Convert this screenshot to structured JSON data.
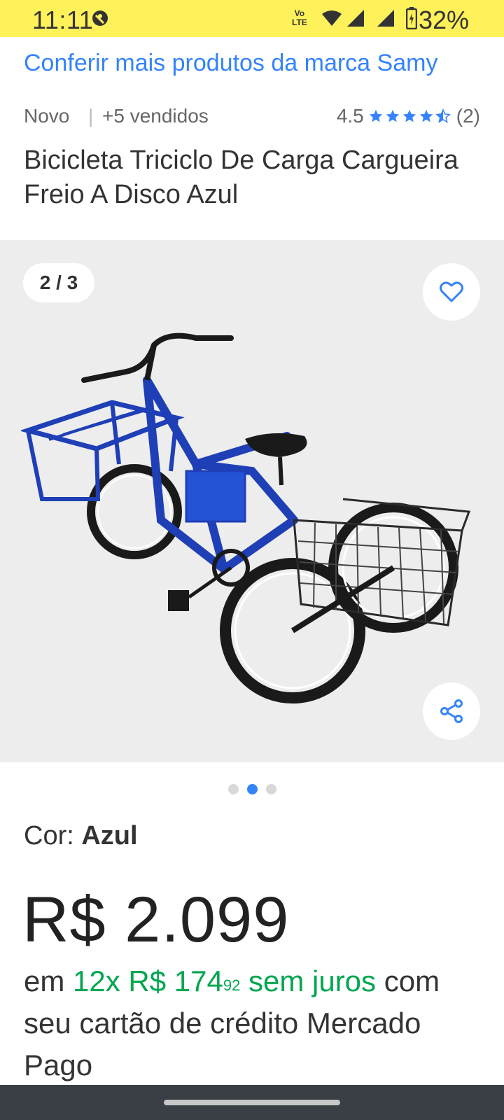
{
  "status_bar": {
    "time": "11:11",
    "battery_percent": "32%",
    "icons": [
      "do-not-disturb-icon",
      "volte-icon",
      "wifi-icon",
      "signal-icon",
      "signal-icon-2",
      "battery-charging-icon"
    ],
    "background": "#fff159"
  },
  "header": {
    "brand_link": "Conferir mais produtos da marca Samy"
  },
  "meta": {
    "condition": "Novo",
    "separator": "|",
    "sold": "+5 vendidos",
    "rating_value": "4.5",
    "rating_count": "(2)",
    "stars": 4.5
  },
  "product": {
    "title": "Bicicleta Triciclo De Carga Cargueira Freio A Disco Azul"
  },
  "gallery": {
    "counter": "2 / 3",
    "current_index": 2,
    "total": 3,
    "favorite_icon": "heart-icon",
    "share_icon": "share-icon",
    "image_alt": "tricycle-blue-product-photo"
  },
  "color": {
    "label": "Cor: ",
    "value": "Azul"
  },
  "price": {
    "main": "R$ 2.099",
    "installments_prefix": "em ",
    "installments_count": "12x R$ 174",
    "installments_cents": "92",
    "installments_interest": " sem juros",
    "installments_suffix": " com seu cartão de crédito Mercado Pago"
  },
  "colors": {
    "link_blue": "#3483fa",
    "green": "#00a650",
    "yellow": "#fff159"
  }
}
